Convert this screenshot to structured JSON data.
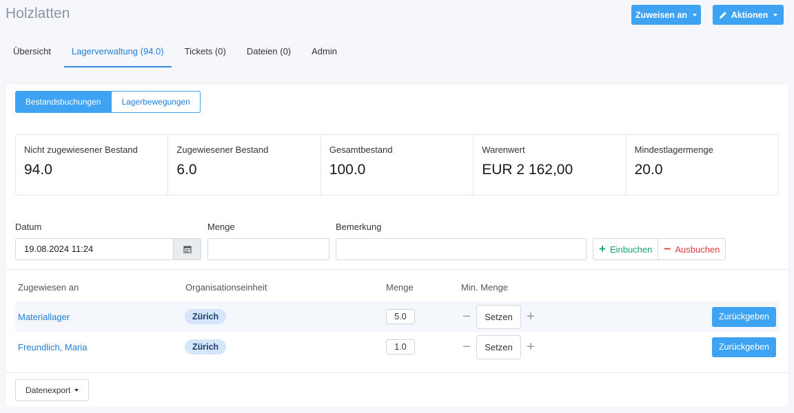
{
  "header": {
    "title": "Holzlatten",
    "assign_label": "Zuweisen an",
    "actions_label": "Aktionen",
    "actions_icon": "pencil-icon"
  },
  "tabs": [
    {
      "label": "Übersicht",
      "active": false
    },
    {
      "label": "Lagerverwaltung (94.0)",
      "active": true
    },
    {
      "label": "Tickets (0)",
      "active": false
    },
    {
      "label": "Dateien (0)",
      "active": false
    },
    {
      "label": "Admin",
      "active": false
    }
  ],
  "segment": {
    "bookings_label": "Bestandsbuchungen",
    "movements_label": "Lagerbewegungen",
    "selected": "Bestandsbuchungen"
  },
  "stats": [
    {
      "label": "Nicht zugewiesener Bestand",
      "value": "94.0"
    },
    {
      "label": "Zugewiesener Bestand",
      "value": "6.0"
    },
    {
      "label": "Gesamtbestand",
      "value": "100.0"
    },
    {
      "label": "Warenwert",
      "value": "EUR 2 162,00"
    },
    {
      "label": "Mindestlagermenge",
      "value": "20.0"
    }
  ],
  "form": {
    "date_label": "Datum",
    "date_value": "19.08.2024 11:24",
    "calendar_icon": "calendar-icon",
    "quantity_label": "Menge",
    "quantity_value": "",
    "remark_label": "Bemerkung",
    "remark_value": "",
    "book_in_label": "Einbuchen",
    "book_out_label": "Ausbuchen"
  },
  "table": {
    "headers": {
      "assigned_to": "Zugewiesen an",
      "org_unit": "Organisationseinheit",
      "quantity": "Menge",
      "min_quantity": "Min. Menge"
    },
    "rows": [
      {
        "assigned_to": "Materiallager",
        "org_unit": "Zürich",
        "quantity": "5.0",
        "set_label": "Setzen",
        "return_label": "Zurückgeben"
      },
      {
        "assigned_to": "Freundlich, Maria",
        "org_unit": "Zürich",
        "quantity": "1.0",
        "set_label": "Setzen",
        "return_label": "Zurückgeben"
      }
    ]
  },
  "footer": {
    "export_label": "Datenexport"
  },
  "colors": {
    "primary": "#3ea3f2",
    "link": "#1f7ed6",
    "success": "#1aa37a",
    "danger": "#e03a3a",
    "pill_bg": "#d6e6fa"
  }
}
